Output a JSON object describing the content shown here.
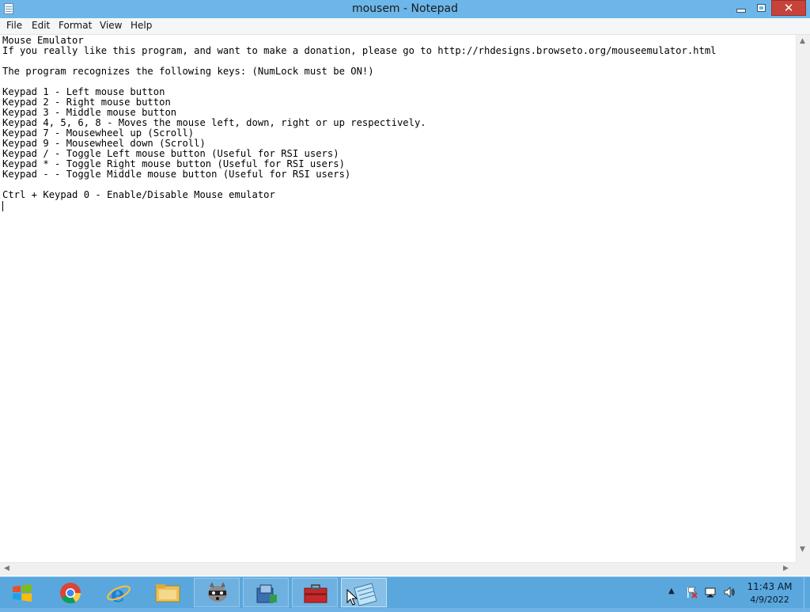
{
  "window": {
    "title": "mousem - Notepad",
    "close_glyph": "✕"
  },
  "menu": [
    "File",
    "Edit",
    "Format",
    "View",
    "Help"
  ],
  "document": {
    "lines": [
      "Mouse Emulator",
      "If you really like this program, and want to make a donation, please go to http://rhdesigns.browseto.org/mouseemulator.html",
      "",
      "The program recognizes the following keys: (NumLock must be ON!)",
      "",
      "Keypad 1 - Left mouse button",
      "Keypad 2 - Right mouse button",
      "Keypad 3 - Middle mouse button",
      "Keypad 4, 5, 6, 8 - Moves the mouse left, down, right or up respectively.",
      "Keypad 7 - Mousewheel up (Scroll)",
      "Keypad 9 - Mousewheel down (Scroll)",
      "Keypad / - Toggle Left mouse button (Useful for RSI users)",
      "Keypad * - Toggle Right mouse button (Useful for RSI users)",
      "Keypad - - Toggle Middle mouse button (Useful for RSI users)",
      "",
      "Ctrl + Keypad 0 - Enable/Disable Mouse emulator",
      ""
    ]
  },
  "scrollbars": {
    "up": "▲",
    "down": "▼",
    "left": "◀",
    "right": "▶"
  },
  "taskbar": {
    "buttons": [
      {
        "name": "chrome-icon"
      },
      {
        "name": "internet-explorer-icon"
      },
      {
        "name": "file-explorer-icon"
      },
      {
        "name": "raccoon-app-icon"
      },
      {
        "name": "installer-package-icon"
      },
      {
        "name": "toolbox-app-icon"
      },
      {
        "name": "notepad-icon"
      }
    ],
    "tray": {
      "arrow": "▲",
      "icons": [
        "action-center-flag-icon",
        "network-icon",
        "volume-icon"
      ]
    },
    "clock": {
      "time": "11:43 AM",
      "date": "4/9/2022"
    }
  },
  "colors": {
    "titlebar": "#6cb6ea",
    "taskbar": "#5aa7dd",
    "close_button": "#c7433a"
  }
}
